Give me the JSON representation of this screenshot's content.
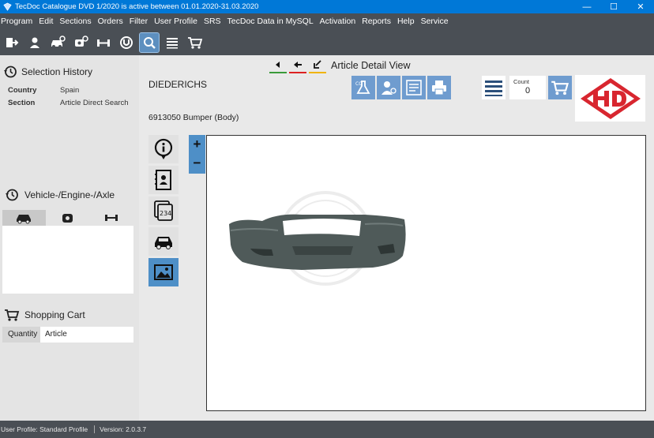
{
  "window": {
    "title": "TecDoc Catalogue DVD   1/2020 is active between 01.01.2020-31.03.2020",
    "minimize": "—",
    "maximize": "☐",
    "close": "✕"
  },
  "menu": [
    "Program",
    "Edit",
    "Sections",
    "Orders",
    "Filter",
    "User Profile",
    "SRS",
    "TecDoc Data in MySQL",
    "Activation",
    "Reports",
    "Help",
    "Service"
  ],
  "toolbar_icons": [
    "exit-icon",
    "user-icon",
    "vehicle-search-icon",
    "engine-search-icon",
    "axle-search-icon",
    "universal-parts-icon",
    "article-search-icon",
    "list-icon",
    "shopping-cart-icon"
  ],
  "left_panel": {
    "selection_history": {
      "title": "Selection History",
      "rows": [
        {
          "key": "Country",
          "value": "Spain"
        },
        {
          "key": "Section",
          "value": "Article Direct Search"
        }
      ]
    },
    "vehicle": {
      "title": "Vehicle-/Engine-/Axle"
    },
    "cart": {
      "title": "Shopping Cart",
      "quantity_label": "Quantity",
      "article_label": "Article"
    }
  },
  "main": {
    "page_title": "Article Detail View",
    "brand": "DIEDERICHS",
    "article": "6913050 Bumper (Body)",
    "count_label": "Count",
    "count_value": "0",
    "zoom_in": "+",
    "zoom_out": "−"
  },
  "status": {
    "profile": "User Profile: Standard Profile",
    "version": "Version: 2.0.3.7"
  },
  "colors": {
    "titlebar": "#0078d7",
    "menubar": "#4a4f55",
    "accent": "#4e8fc7",
    "logo_red": "#d8262f",
    "bumper": "#4f5a59"
  }
}
